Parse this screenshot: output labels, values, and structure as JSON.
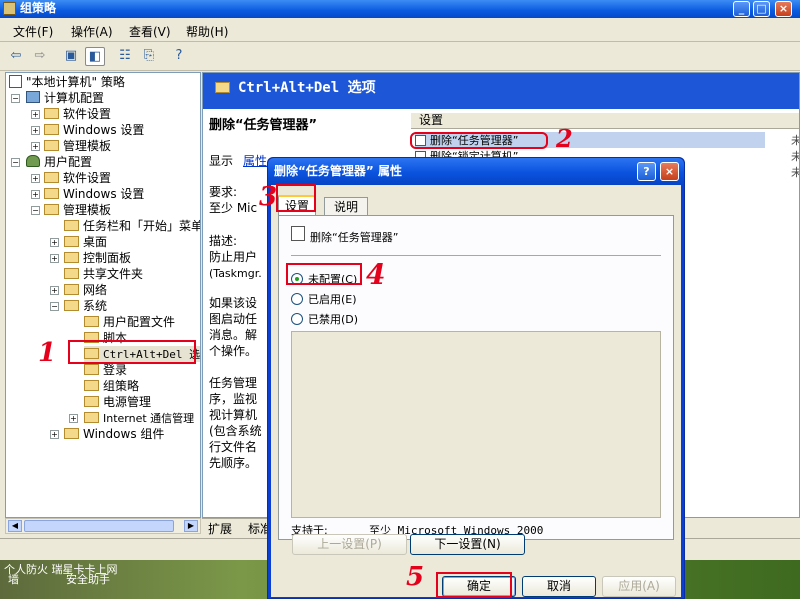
{
  "window": {
    "title": "组策略"
  },
  "menu": [
    "文件(F)",
    "操作(A)",
    "查看(V)",
    "帮助(H)"
  ],
  "tree": {
    "root": "\"本地计算机\" 策略",
    "computer": "计算机配置",
    "computer_children": [
      "软件设置",
      "Windows 设置",
      "管理模板"
    ],
    "user": "用户配置",
    "user_children": [
      "软件设置",
      "Windows 设置",
      "管理模板"
    ],
    "admin_children": [
      "任务栏和「开始」菜单",
      "桌面",
      "控制面板",
      "共享文件夹",
      "网络",
      "系统"
    ],
    "system_children": [
      "用户配置文件",
      "脚本",
      "Ctrl+Alt+Del 选项",
      "登录",
      "组策略",
      "电源管理",
      "Internet 通信管理"
    ],
    "after": "Windows 组件"
  },
  "right": {
    "header": "Ctrl+Alt+Del 选项",
    "setting_title": "删除“任务管理器”",
    "show_label": "显示",
    "properties_link": "属性",
    "req_label": "要求:",
    "req_text": "至少 Mic",
    "desc_label": "描述:",
    "desc_lines": [
      "防止用户",
      "(Taskmgr."
    ],
    "para1": [
      "如果该设",
      "图启动任",
      "消息。解",
      "个操作。"
    ],
    "para2": [
      "任务管理",
      "序，监视",
      "视计算机",
      "(包含系统",
      "行文件名",
      "先顺序。"
    ],
    "settings_col": "设置",
    "rows": [
      "删除“任务管理器”",
      "删除“锁定计算机”"
    ],
    "tabs": [
      "扩展",
      "标准"
    ],
    "state_stub": [
      "未",
      "未",
      "未"
    ]
  },
  "dialog": {
    "title": "删除“任务管理器” 属性",
    "tabs": [
      "设置",
      "说明"
    ],
    "policy": "删除“任务管理器”",
    "options": [
      "未配置(C)",
      "已启用(E)",
      "已禁用(D)"
    ],
    "selected": 0,
    "support_label": "支持于:",
    "support_value": "至少 Microsoft Windows 2000",
    "prev": "上一设置(P)",
    "next": "下一设置(N)",
    "ok": "确定",
    "cancel": "取消",
    "apply": "应用(A)"
  },
  "desktop": {
    "line1": "个人防火 瑞星卡卡上网",
    "line2a": "墙",
    "line2b": "安全助手"
  },
  "annotations": [
    "1",
    "2",
    "3",
    "4",
    "5"
  ],
  "colors": {
    "highlight": "#e5001c",
    "header_bg": "#1d56d6"
  }
}
